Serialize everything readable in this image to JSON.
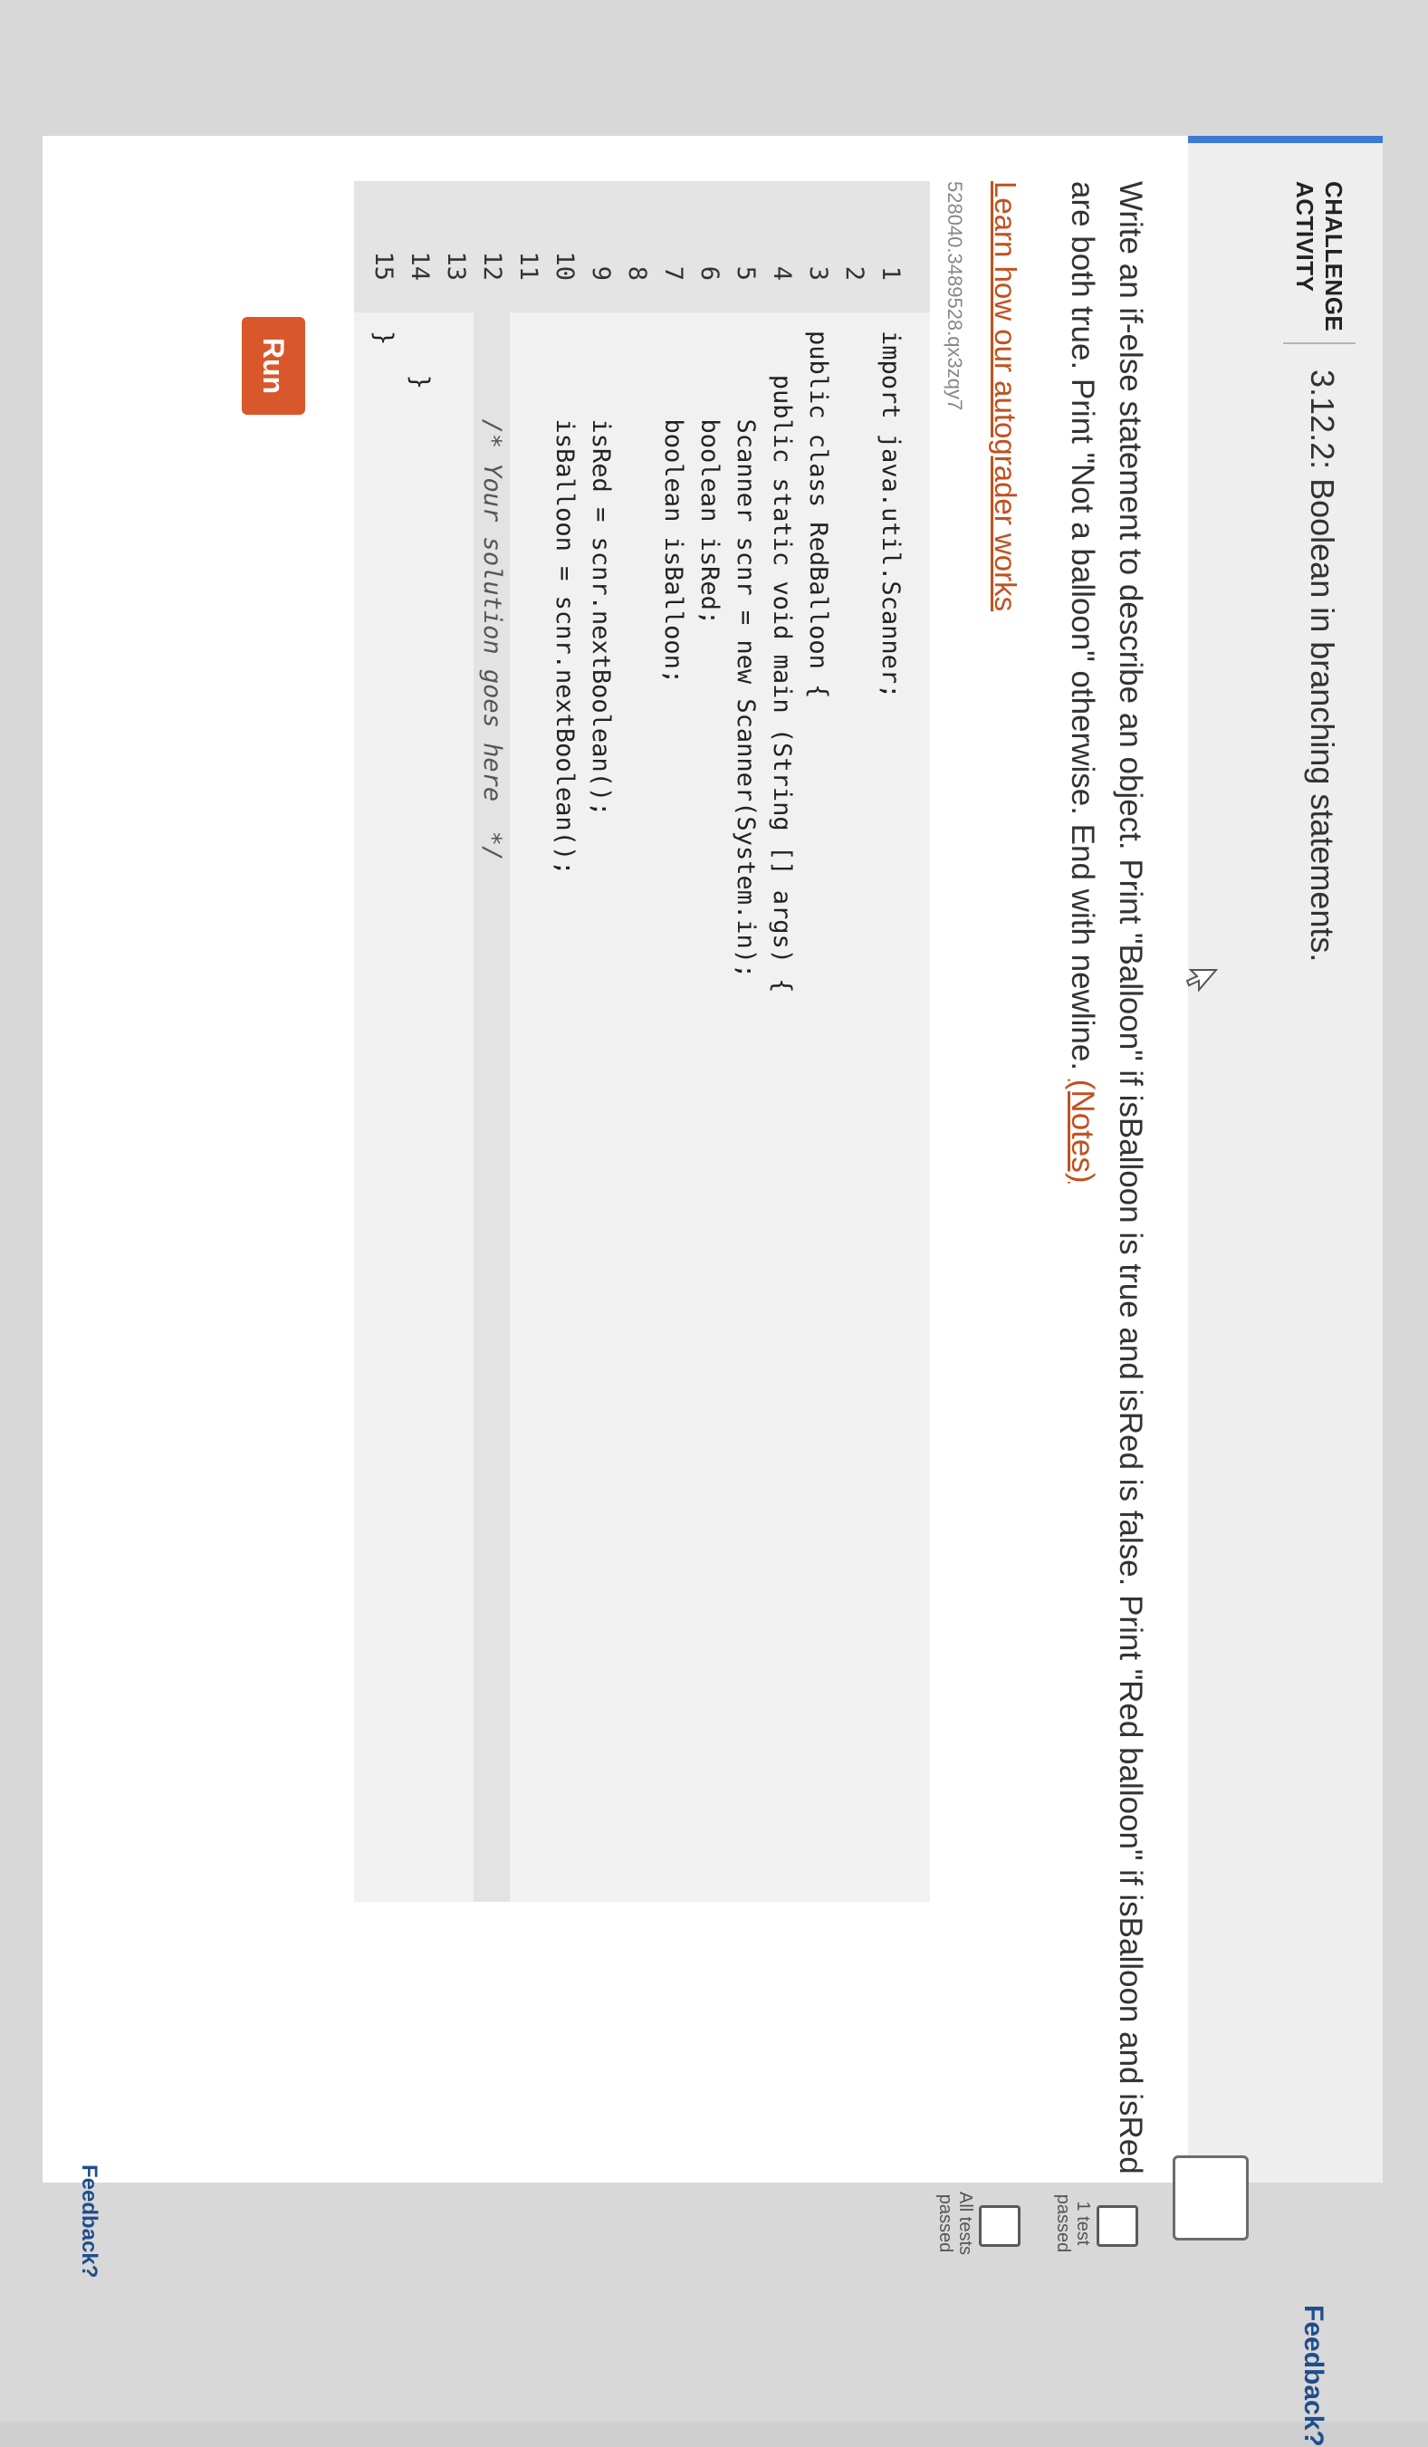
{
  "header": {
    "badge_line1": "CHALLENGE",
    "badge_line2": "ACTIVITY",
    "title": "3.12.2: Boolean in branching statements."
  },
  "instructions": {
    "text": "Write an if-else statement to describe an object. Print \"Balloon\" if isBalloon is true and isRed is false. Print \"Red balloon\" if isBalloon and isRed are both true. Print \"Not a balloon\" otherwise. End with newline. ",
    "notes_link": "(Notes)"
  },
  "learn_link": "Learn how our autograder works",
  "activity_id": "528040.3489528.qx3zqy7",
  "code": [
    {
      "num": "1",
      "text": "import java.util.Scanner;"
    },
    {
      "num": "2",
      "text": ""
    },
    {
      "num": "3",
      "text": "public class RedBalloon {"
    },
    {
      "num": "4",
      "text": "   public static void main (String [] args) {"
    },
    {
      "num": "5",
      "text": "      Scanner scnr = new Scanner(System.in);"
    },
    {
      "num": "6",
      "text": "      boolean isRed;"
    },
    {
      "num": "7",
      "text": "      boolean isBalloon;"
    },
    {
      "num": "8",
      "text": ""
    },
    {
      "num": "9",
      "text": "      isRed = scnr.nextBoolean();"
    },
    {
      "num": "10",
      "text": "      isBalloon = scnr.nextBoolean();"
    },
    {
      "num": "11",
      "text": ""
    },
    {
      "num": "12",
      "text": "      /* Your solution goes here  */"
    },
    {
      "num": "13",
      "text": ""
    },
    {
      "num": "14",
      "text": "   }"
    },
    {
      "num": "15",
      "text": "}"
    }
  ],
  "run_label": "Run",
  "tests": {
    "first": "1 test passed",
    "all": "All tests passed"
  },
  "feedback_top": "Feedback?",
  "feedback_bottom": "Feedback?",
  "colors": {
    "accent": "#3a7bd5",
    "run_button": "#d8582b",
    "link": "#c1511f",
    "feedback_link": "#1f4e8c"
  },
  "icons": {
    "cursor": "mouse-pointer-icon"
  }
}
